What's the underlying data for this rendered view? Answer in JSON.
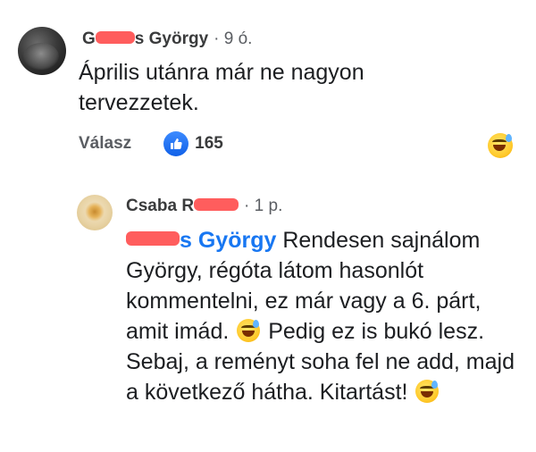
{
  "comment1": {
    "author_visible_start": "G",
    "author_visible_end": "s György",
    "time": "· 9 ó.",
    "text": "Április utánra már ne nagyon tervezzetek.",
    "reply_label": "Válasz",
    "like_count": "165",
    "reaction_icon": "grinning-sweat-emoji"
  },
  "comment2": {
    "author_first": "Csaba",
    "author_visible_partial": "R",
    "time": "· 1 p.",
    "mention_visible_end": "s György",
    "text_parts": [
      " Rendesen sajnálom György, régóta látom hasonlót kommentelni, ez már vagy a 6. párt, amit imád. ",
      " Pedig ez is bukó lesz. Sebaj, a reményt soha fel ne add, majd a következő hátha. Kitartást! "
    ],
    "emoji_icon": "grinning-sweat-emoji"
  },
  "colors": {
    "mention": "#1877f2",
    "like_blue": "#1161e8",
    "redaction": "#ff5d5d"
  }
}
